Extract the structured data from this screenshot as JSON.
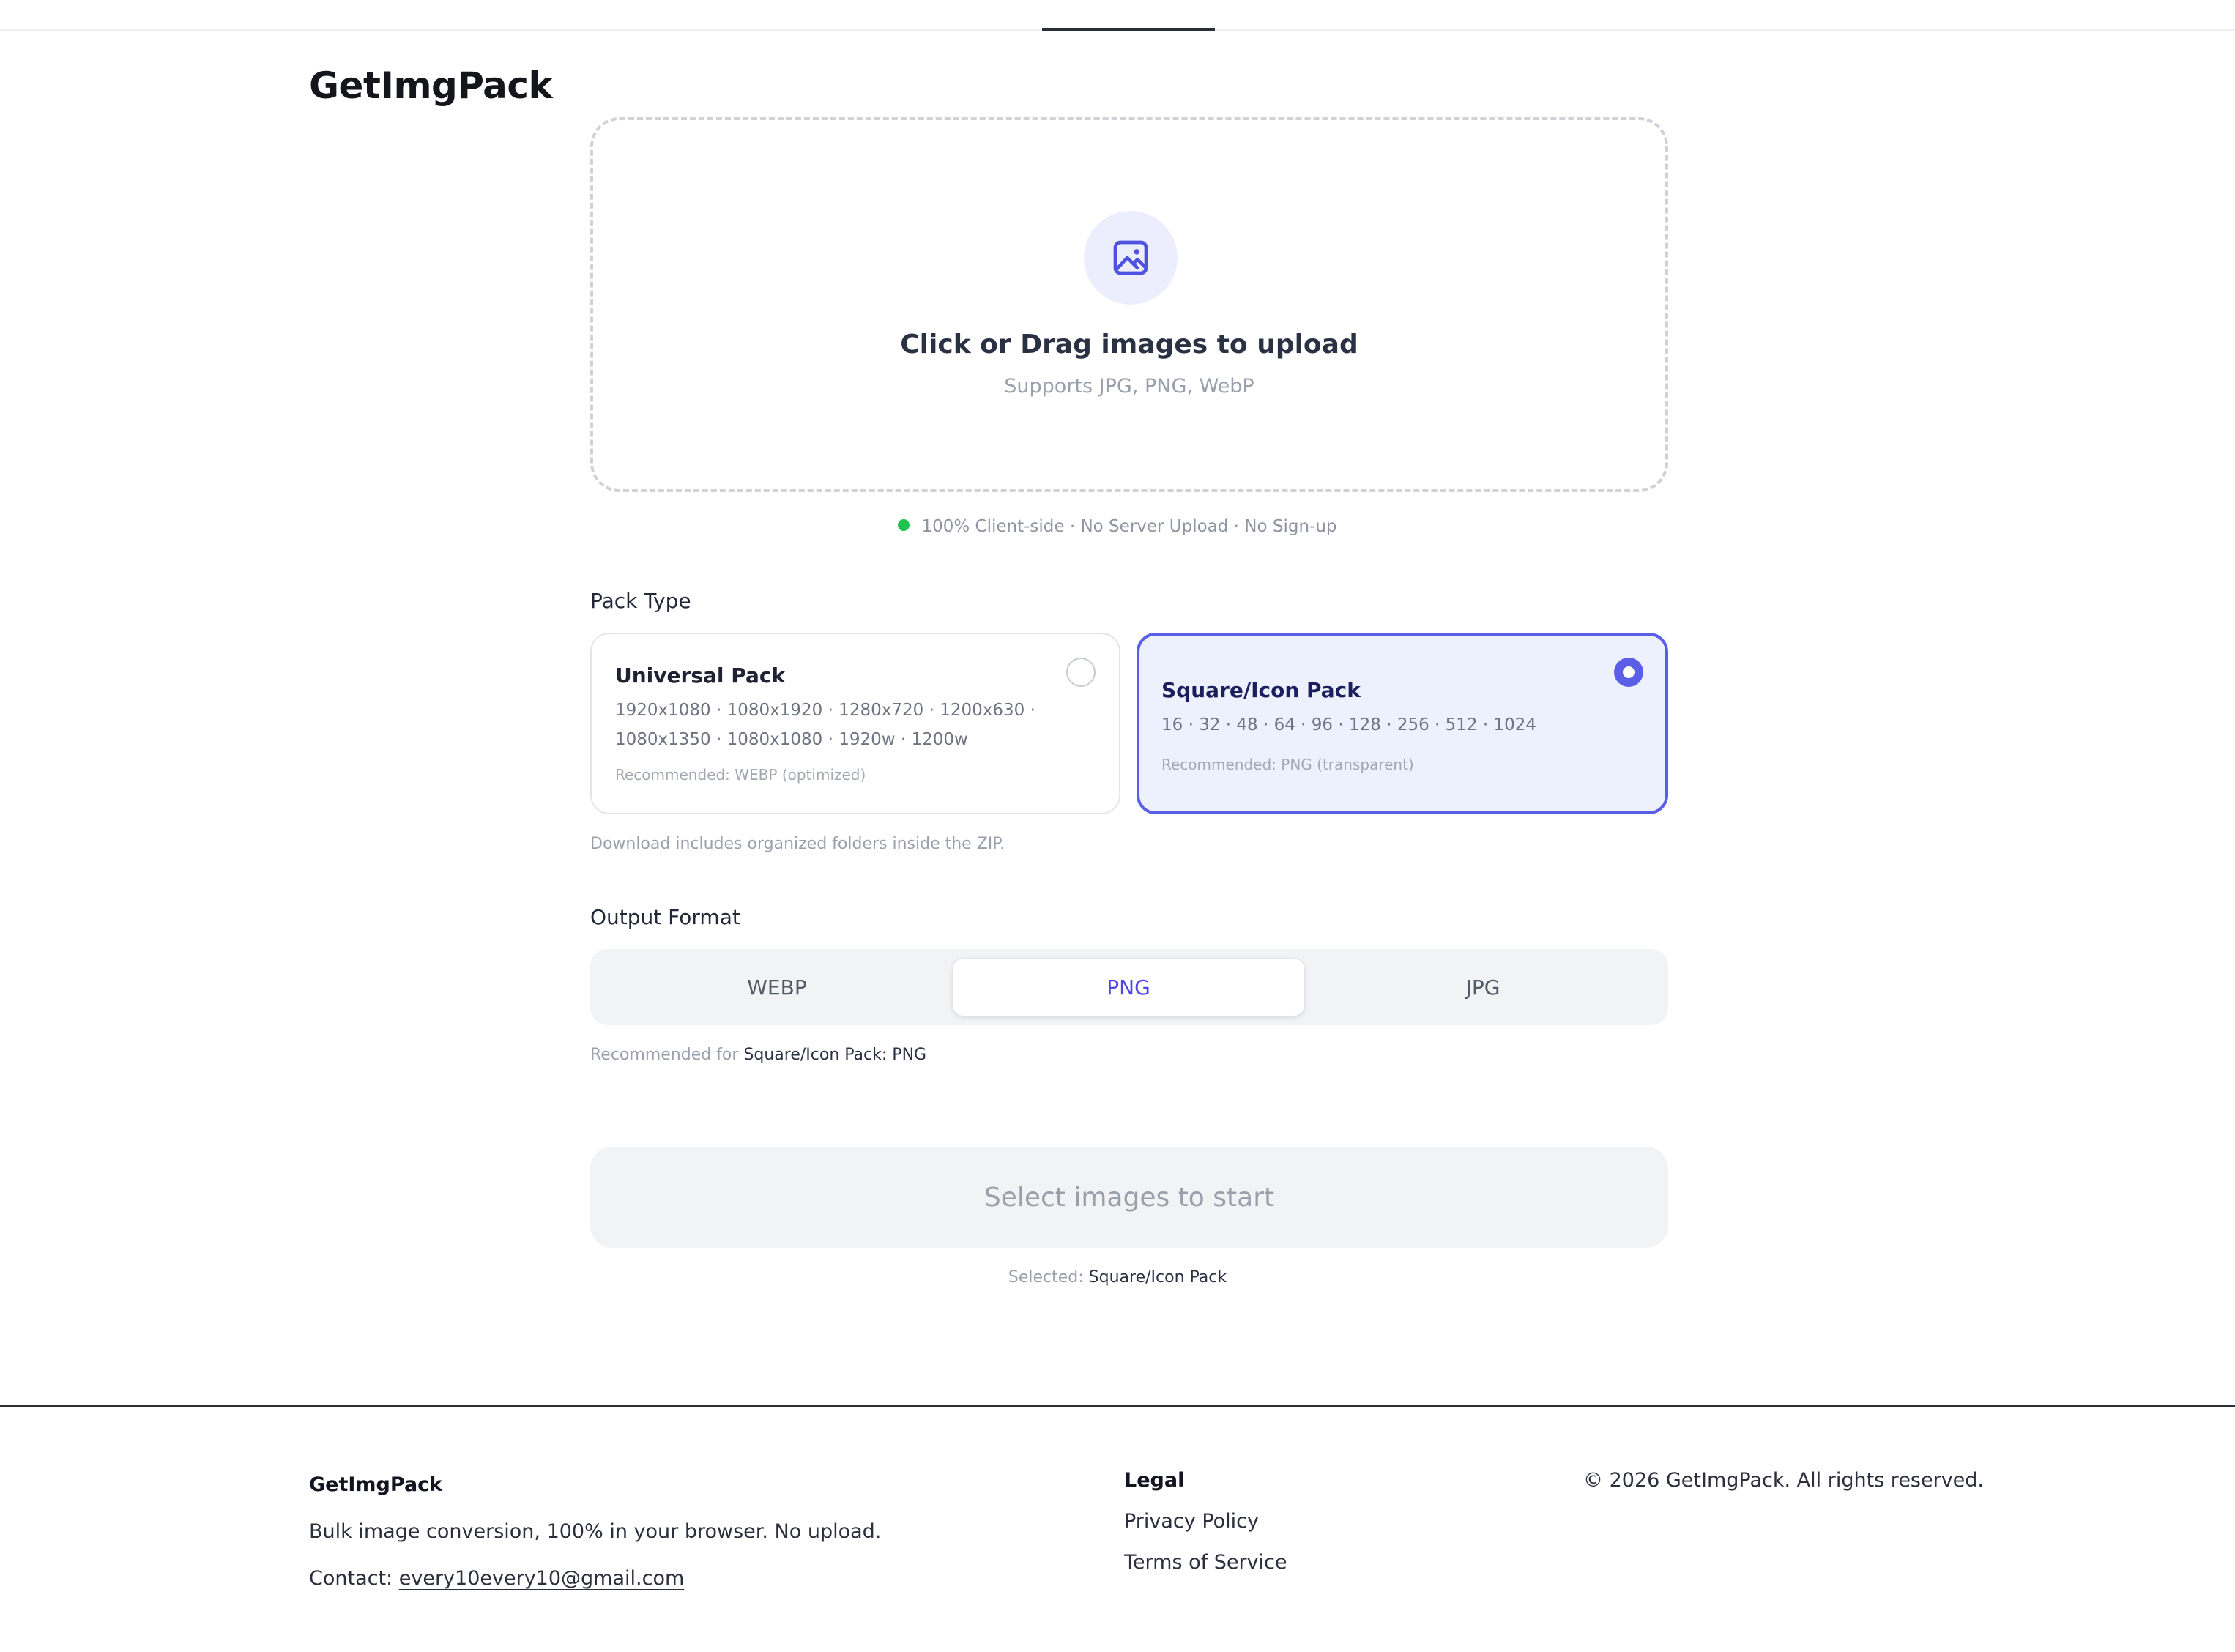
{
  "brand": "GetImgPack",
  "upload": {
    "title": "Click or Drag images to upload",
    "subtitle": "Supports JPG, PNG, WebP"
  },
  "privacy_note": "100% Client-side · No Server Upload · No Sign-up",
  "pack_type": {
    "label": "Pack Type",
    "options": [
      {
        "title": "Universal Pack",
        "sizes_line1": "1920x1080 · 1080x1920 · 1280x720 · 1200x630 ·",
        "sizes_line2": "1080x1350 · 1080x1080 · 1920w · 1200w",
        "recommended": "Recommended: WEBP (optimized)",
        "selected": false
      },
      {
        "title": "Square/Icon Pack",
        "sizes_line1": "16 · 32 · 48 · 64 · 96 · 128 · 256 · 512 · 1024",
        "recommended": "Recommended: PNG (transparent)",
        "selected": true
      }
    ],
    "note": "Download includes organized folders inside the ZIP."
  },
  "output_format": {
    "label": "Output Format",
    "options": [
      "WEBP",
      "PNG",
      "JPG"
    ],
    "selected": "PNG",
    "recommendation_prefix": "Recommended for",
    "recommendation_pack": "Square/Icon Pack",
    "recommendation_suffix": ": PNG"
  },
  "start_button": "Select images to start",
  "selected_status": {
    "prefix": "Selected:",
    "value": "Square/Icon Pack"
  },
  "footer": {
    "brand": "GetImgPack",
    "tagline": "Bulk image conversion, 100% in your browser. No upload.",
    "contact_label": "Contact:",
    "contact_email": "every10every10@gmail.com",
    "legal_heading": "Legal",
    "privacy_link": "Privacy Policy",
    "terms_link": "Terms of Service",
    "copyright": "© 2026 GetImgPack. All rights reserved."
  },
  "colors": {
    "accent": "#5b5fe8",
    "status_green": "#1ec24e",
    "selected_card_bg": "#edf0fd"
  },
  "icons": {
    "upload": "image-icon",
    "status": "status-dot-icon"
  }
}
